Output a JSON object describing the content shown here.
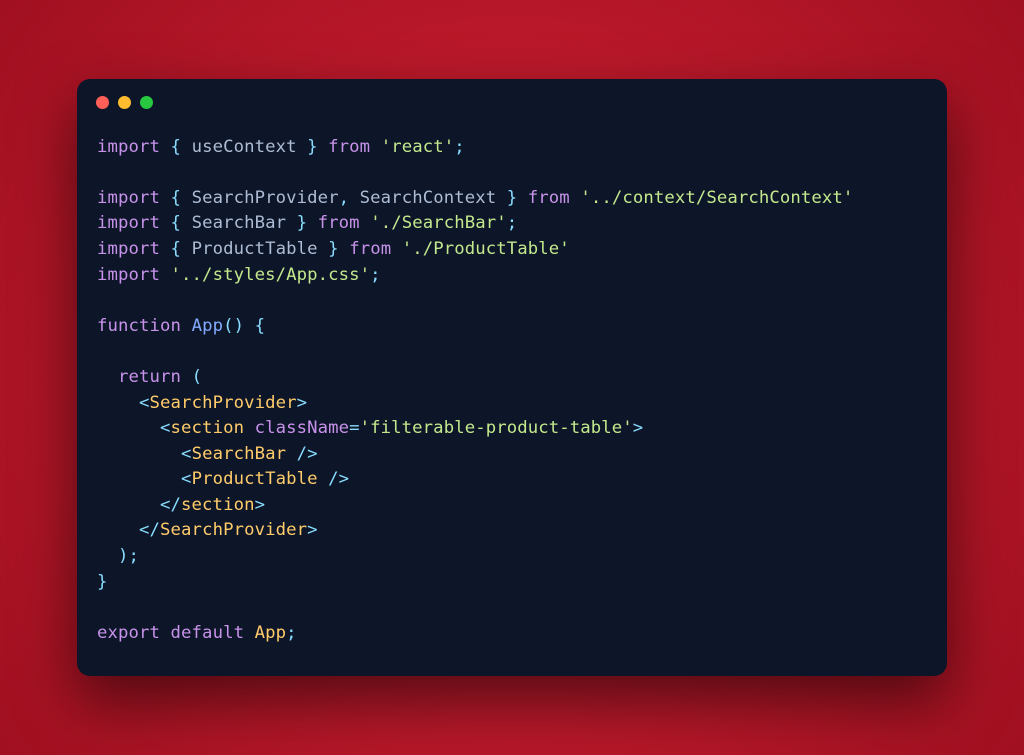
{
  "window": {
    "dots": [
      "close",
      "minimize",
      "maximize"
    ]
  },
  "code": {
    "lines": [
      {
        "type": "import_named",
        "names": [
          "useContext"
        ],
        "from": "'react'",
        "semi": true
      },
      {
        "type": "blank"
      },
      {
        "type": "import_named",
        "names": [
          "SearchProvider",
          "SearchContext"
        ],
        "from": "'../context/SearchContext'",
        "semi": false
      },
      {
        "type": "import_named",
        "names": [
          "SearchBar"
        ],
        "from": "'./SearchBar'",
        "semi": true
      },
      {
        "type": "import_named",
        "names": [
          "ProductTable"
        ],
        "from": "'./ProductTable'",
        "semi": false
      },
      {
        "type": "import_side",
        "from": "'../styles/App.css'",
        "semi": true
      },
      {
        "type": "blank"
      },
      {
        "type": "fn_decl",
        "name": "App"
      },
      {
        "type": "blank"
      },
      {
        "type": "return_open"
      },
      {
        "type": "jsx_open",
        "indent": 4,
        "tag": "SearchProvider"
      },
      {
        "type": "jsx_open_attr",
        "indent": 6,
        "tag": "section",
        "attr": "className",
        "val": "'filterable-product-table'"
      },
      {
        "type": "jsx_self",
        "indent": 8,
        "tag": "SearchBar"
      },
      {
        "type": "jsx_self",
        "indent": 8,
        "tag": "ProductTable"
      },
      {
        "type": "jsx_close",
        "indent": 6,
        "tag": "section"
      },
      {
        "type": "jsx_close",
        "indent": 4,
        "tag": "SearchProvider"
      },
      {
        "type": "return_close"
      },
      {
        "type": "brace_close"
      },
      {
        "type": "blank"
      },
      {
        "type": "export_default",
        "name": "App"
      }
    ]
  }
}
